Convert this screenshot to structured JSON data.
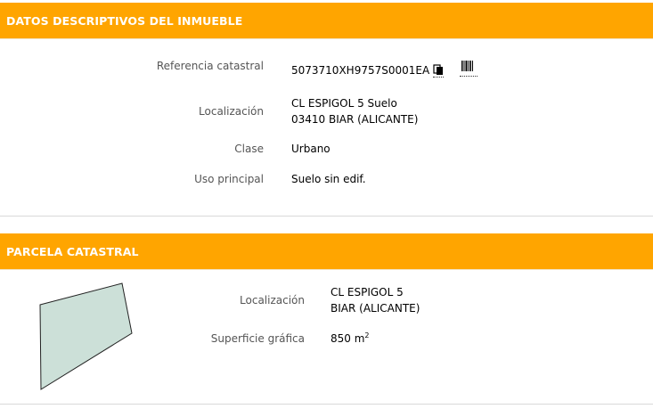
{
  "inmueble": {
    "title": "DATOS DESCRIPTIVOS DEL INMUEBLE",
    "rows": [
      {
        "label": "Referencia catastral",
        "value": "5073710XH9757S0001EA"
      },
      {
        "label": "Localización",
        "line1": "CL ESPIGOL 5 Suelo",
        "line2": "03410 BIAR (ALICANTE)"
      },
      {
        "label": "Clase",
        "value": "Urbano"
      },
      {
        "label": "Uso principal",
        "value": "Suelo sin edif."
      }
    ],
    "icons": {
      "copy": "copy-icon",
      "barcode": "barcode-icon"
    }
  },
  "parcela": {
    "title": "PARCELA CATASTRAL",
    "localizacion_label": "Localización",
    "localizacion_line1": "CL ESPIGOL 5",
    "localizacion_line2": "BIAR (ALICANTE)",
    "superficie_label": "Superficie gráfica",
    "superficie_value": "850 m",
    "superficie_unit_exp": "2",
    "parcel_fill": "#cce0d8",
    "parcel_stroke": "#222222"
  },
  "colors": {
    "accent": "#FFA500"
  }
}
